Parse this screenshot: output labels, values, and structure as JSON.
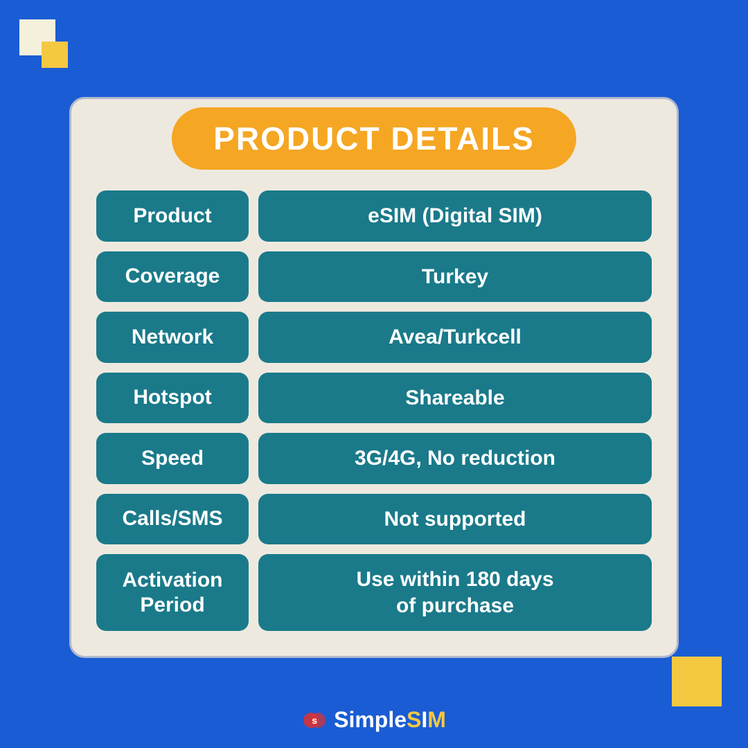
{
  "page": {
    "background_color": "#1a5cd4",
    "title": "PRODUCT DETAILS",
    "title_bg": "#f5a623"
  },
  "rows": [
    {
      "label": "Product",
      "value": "eSIM (Digital SIM)"
    },
    {
      "label": "Coverage",
      "value": "Turkey"
    },
    {
      "label": "Network",
      "value": "Avea/Turkcell"
    },
    {
      "label": "Hotspot",
      "value": "Shareable"
    },
    {
      "label": "Speed",
      "value": "3G/4G, No reduction"
    },
    {
      "label": "Calls/SMS",
      "value": "Not supported"
    },
    {
      "label": "Activation\nPeriod",
      "value": "Use within 180 days\nof purchase"
    }
  ],
  "brand": {
    "name": "SimpleSIM",
    "name_display": "SimpleSIM"
  }
}
